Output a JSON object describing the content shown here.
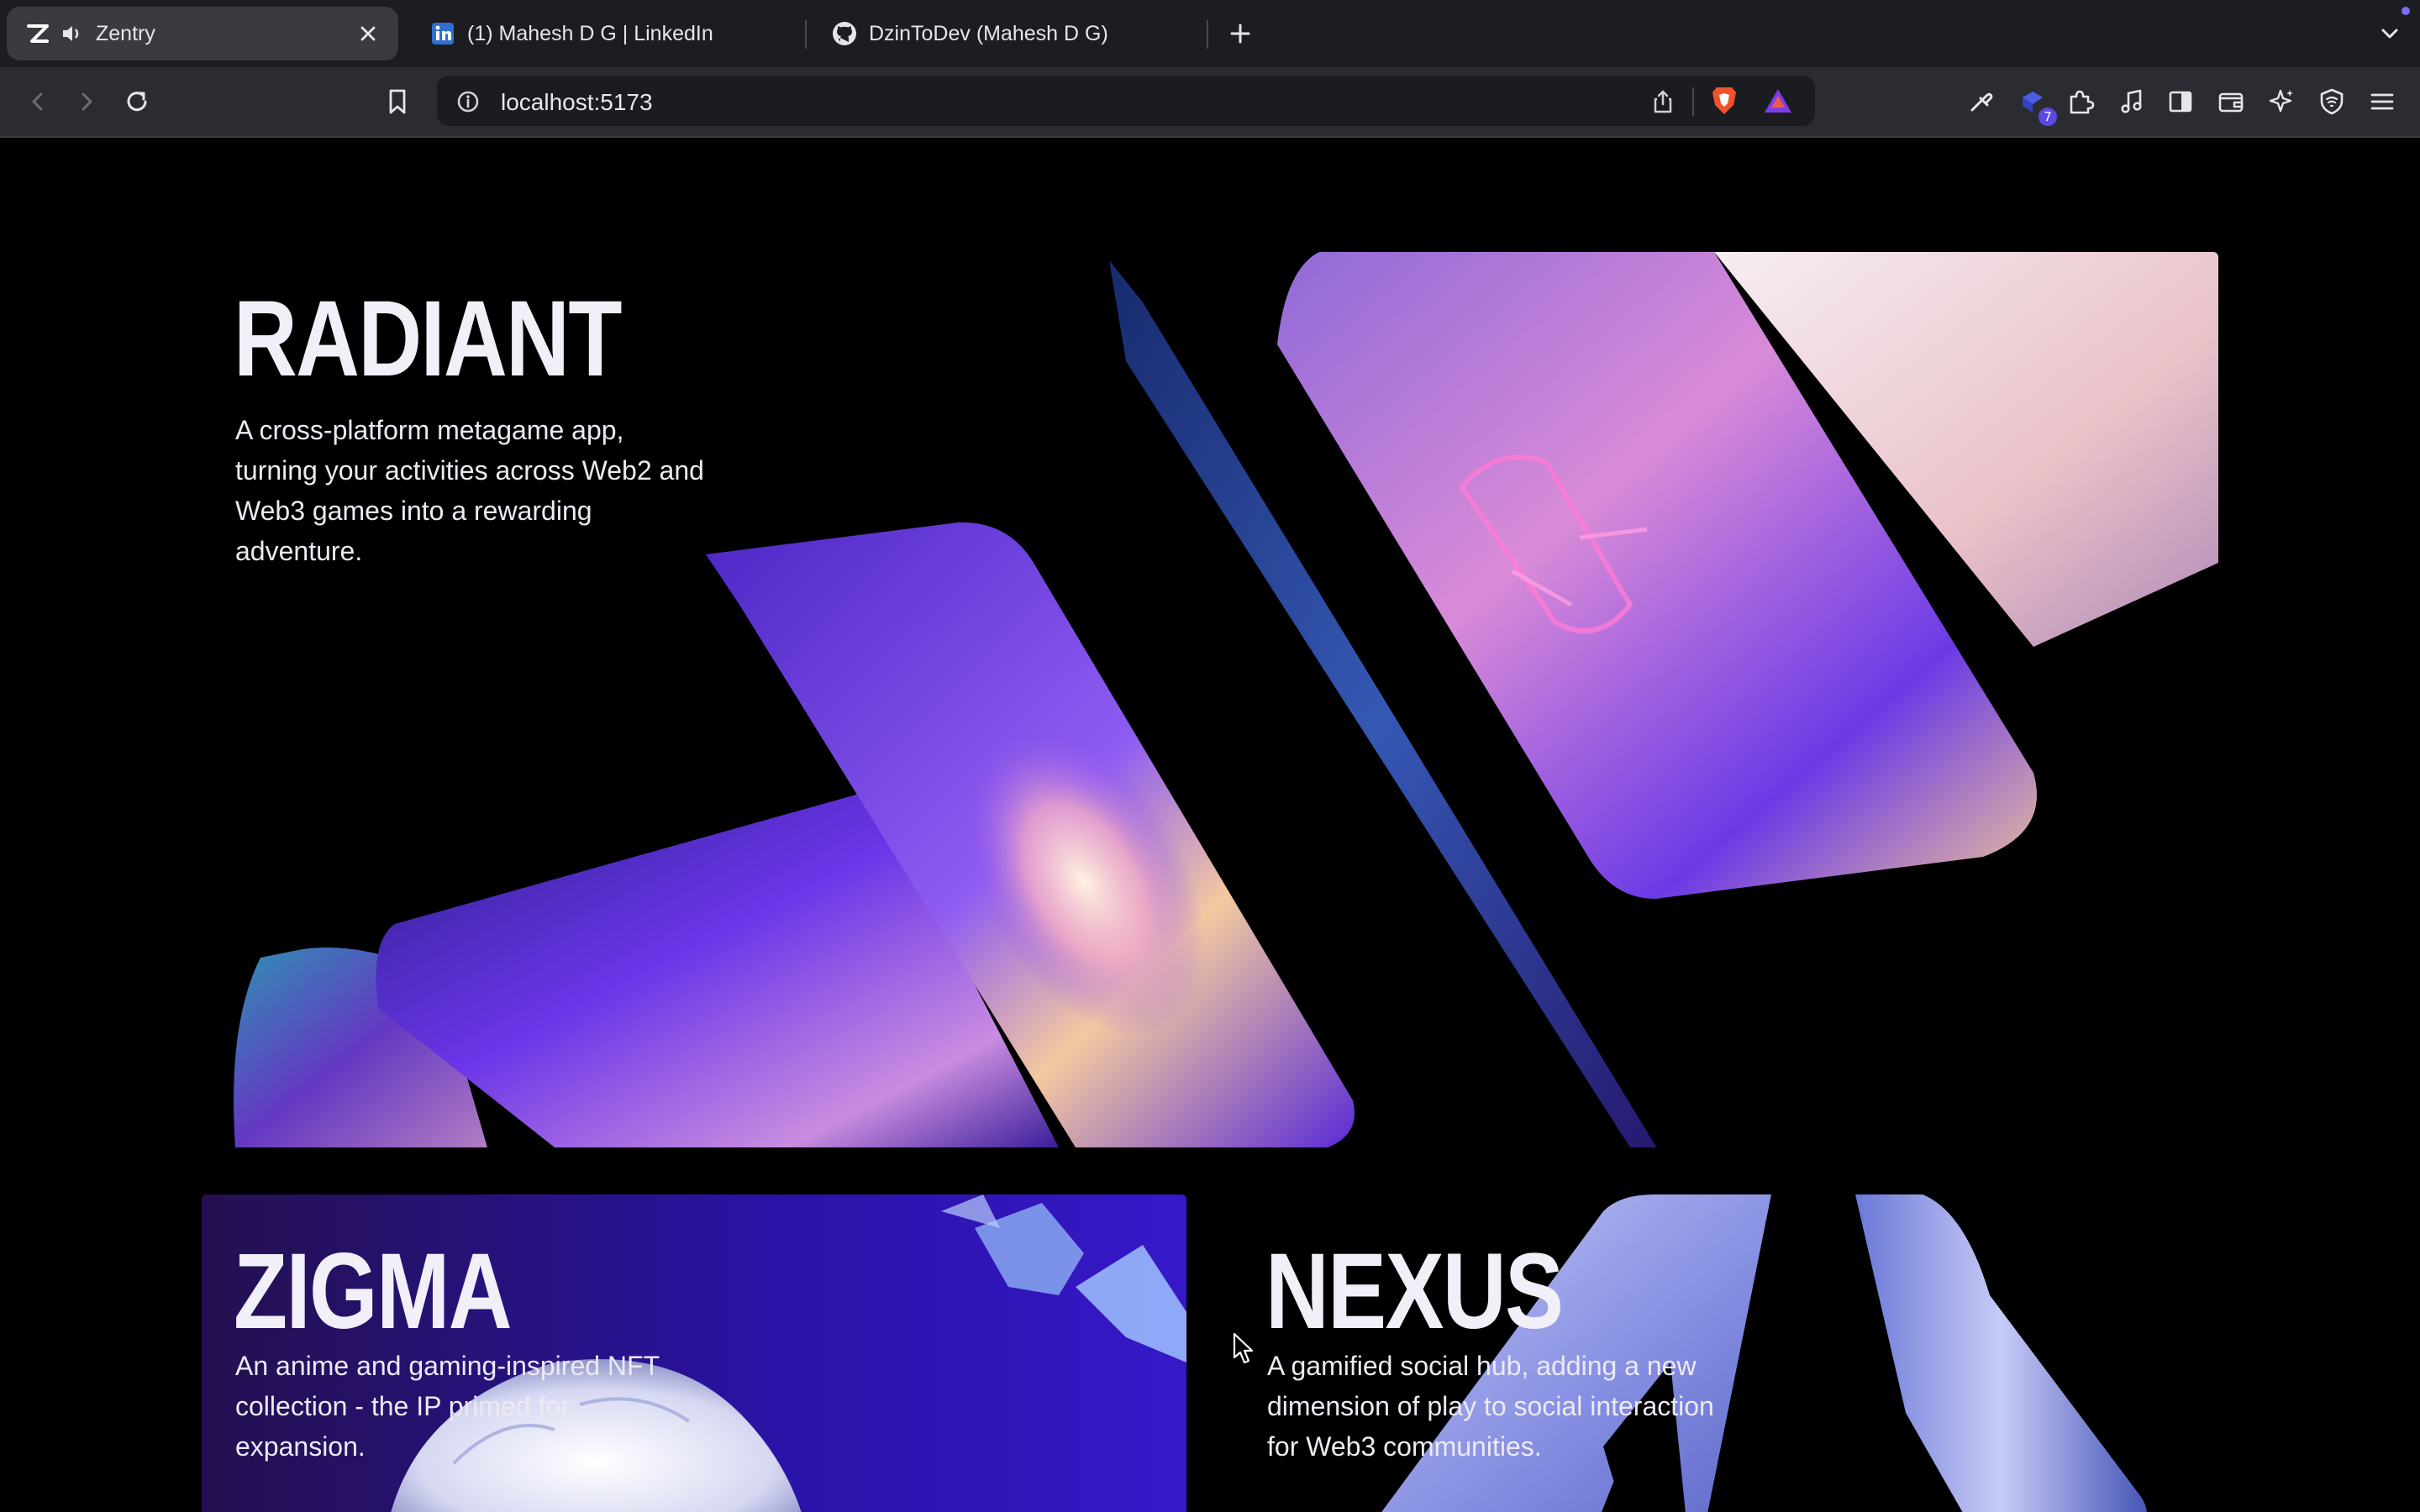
{
  "browser": {
    "tabs": [
      {
        "title": "Zentry",
        "active": true,
        "favicon": "zentry-logo-icon",
        "audio": true
      },
      {
        "title": "(1) Mahesh D G | LinkedIn",
        "active": false,
        "favicon": "linkedin-icon"
      },
      {
        "title": "DzinToDev (Mahesh D G)",
        "active": false,
        "favicon": "github-icon"
      }
    ],
    "address_bar": {
      "url": "localhost:5173"
    },
    "extensions_badge": "7"
  },
  "page": {
    "cards": [
      {
        "title": "RADIANT",
        "description": "A cross-platform metagame app, turning your activities across Web2 and Web3 games into a rewarding adventure."
      },
      {
        "title": "ZIGMA",
        "description": "An anime and gaming-inspired NFT collection - the IP primed for expansion."
      },
      {
        "title": "NEXUS",
        "description": "A gamified social hub, adding a new dimension of play to social interaction for Web3 communities."
      }
    ]
  },
  "colors": {
    "background": "#000000",
    "tabbar": "#1c1d21",
    "toolbar": "#2b2c31",
    "accent_purple": "#6b3cf0",
    "text_primary": "#f1eff8"
  }
}
